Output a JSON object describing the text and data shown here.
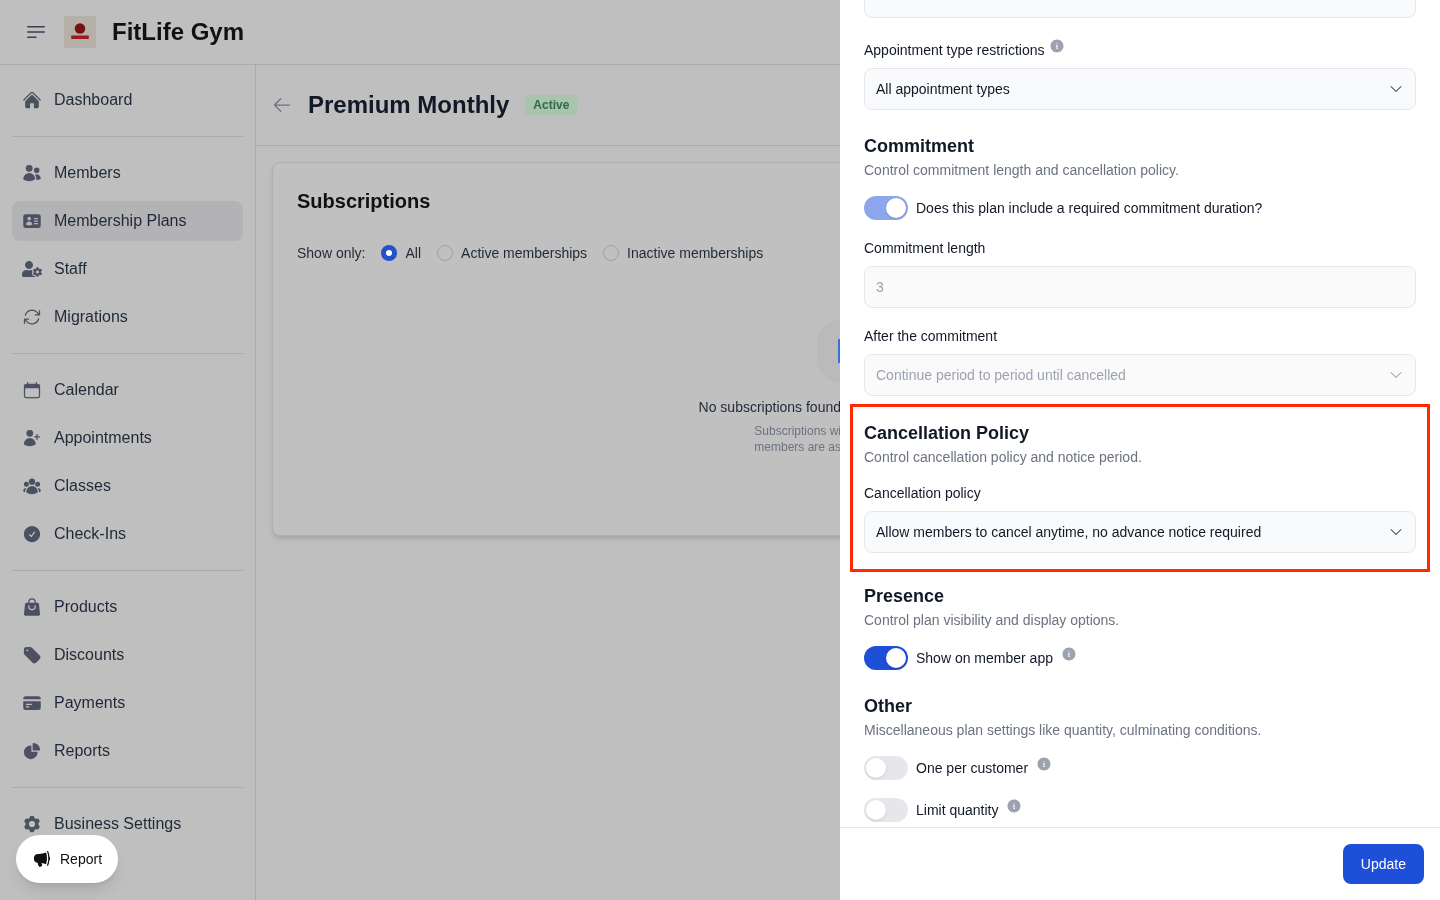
{
  "header": {
    "brand": "FitLife Gym"
  },
  "sidebar": {
    "groups": [
      {
        "items": [
          {
            "label": "Dashboard",
            "selected": false
          }
        ]
      },
      {
        "items": [
          {
            "label": "Members",
            "selected": false
          },
          {
            "label": "Membership Plans",
            "selected": true
          },
          {
            "label": "Staff",
            "selected": false
          },
          {
            "label": "Migrations",
            "selected": false
          }
        ]
      },
      {
        "items": [
          {
            "label": "Calendar",
            "selected": false
          },
          {
            "label": "Appointments",
            "selected": false
          },
          {
            "label": "Classes",
            "selected": false
          },
          {
            "label": "Check-Ins",
            "selected": false
          }
        ]
      },
      {
        "items": [
          {
            "label": "Products",
            "selected": false
          },
          {
            "label": "Discounts",
            "selected": false
          },
          {
            "label": "Payments",
            "selected": false
          },
          {
            "label": "Reports",
            "selected": false
          }
        ]
      },
      {
        "items": [
          {
            "label": "Business Settings",
            "selected": false
          }
        ]
      }
    ]
  },
  "report_button": {
    "label": "Report"
  },
  "page": {
    "title": "Premium Monthly",
    "status": "Active",
    "card": {
      "title": "Subscriptions",
      "filter_label": "Show only:",
      "filters": [
        {
          "label": "All",
          "selected": true
        },
        {
          "label": "Active memberships",
          "selected": false
        },
        {
          "label": "Inactive memberships",
          "selected": false
        }
      ],
      "empty": {
        "title": "No subscriptions found",
        "lines": [
          "Subscriptions wi",
          "members are as"
        ]
      }
    }
  },
  "panel": {
    "sections": [
      {
        "fields": [
          {
            "kind": "select",
            "label": "Appointment type restrictions",
            "info": true,
            "value": "All appointment types",
            "disabled": false
          }
        ]
      },
      {
        "title": "Commitment",
        "description": "Control commitment length and cancellation policy.",
        "highlighted": false,
        "fields": [
          {
            "kind": "toggle",
            "label": "Does this plan include a required commitment duration?",
            "on": true,
            "disabled": true,
            "info": false
          },
          {
            "kind": "input",
            "label": "Commitment length",
            "value": "3",
            "disabled": true
          },
          {
            "kind": "select",
            "label": "After the commitment",
            "value": "Continue period to period until cancelled",
            "disabled": true
          }
        ]
      },
      {
        "title": "Cancellation Policy",
        "description": "Control cancellation policy and notice period.",
        "highlighted": true,
        "fields": [
          {
            "kind": "select",
            "label": "Cancellation policy",
            "value": "Allow members to cancel anytime, no advance notice required",
            "disabled": false
          }
        ]
      },
      {
        "title": "Presence",
        "description": "Control plan visibility and display options.",
        "highlighted": false,
        "fields": [
          {
            "kind": "toggle",
            "label": "Show on member app",
            "on": true,
            "disabled": false,
            "info": true
          }
        ]
      },
      {
        "title": "Other",
        "description": "Miscellaneous plan settings like quantity, culminating conditions.",
        "highlighted": false,
        "fields": [
          {
            "kind": "toggle",
            "label": "One per customer",
            "on": false,
            "info": true
          },
          {
            "kind": "toggle",
            "label": "Limit quantity",
            "on": false,
            "info": true
          }
        ]
      }
    ],
    "submit": "Update"
  }
}
